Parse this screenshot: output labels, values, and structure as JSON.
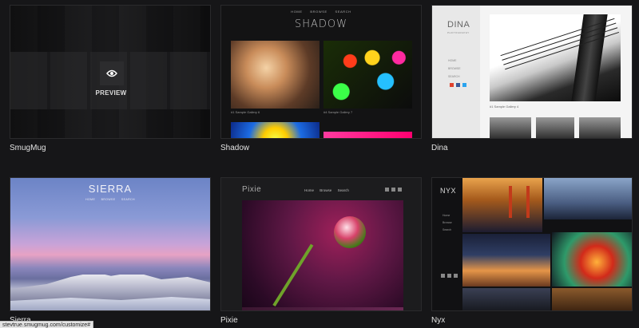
{
  "themes": [
    {
      "name": "SmugMug",
      "preview_label": "PREVIEW"
    },
    {
      "name": "Shadow",
      "title": "SHADOW",
      "nav": [
        "HOME",
        "BROWSE",
        "SEARCH"
      ],
      "captions": [
        "#1 Sample Gallery 6",
        "#4 Sample Gallery 7"
      ]
    },
    {
      "name": "Dina",
      "title": "DINA",
      "subtitle": "PHOTOGRAPHY",
      "nav": [
        "HOME",
        "BROWSE",
        "SEARCH"
      ],
      "caption": "#1 Sample Gallery 4",
      "social_colors": [
        "#e0422e",
        "#3b5998",
        "#2aa3ef"
      ]
    },
    {
      "name": "Sierra",
      "title": "SIERRA",
      "nav": [
        "HOME",
        "BROWSE",
        "SEARCH"
      ]
    },
    {
      "name": "Pixie",
      "title": "Pixie",
      "nav": [
        "Home",
        "Browse",
        "Search"
      ]
    },
    {
      "name": "Nyx",
      "title": "NYX",
      "nav": [
        "Home",
        "Browse",
        "Search"
      ]
    }
  ],
  "status_bar": {
    "url": "stevtrue.smugmug.com/customize#"
  }
}
